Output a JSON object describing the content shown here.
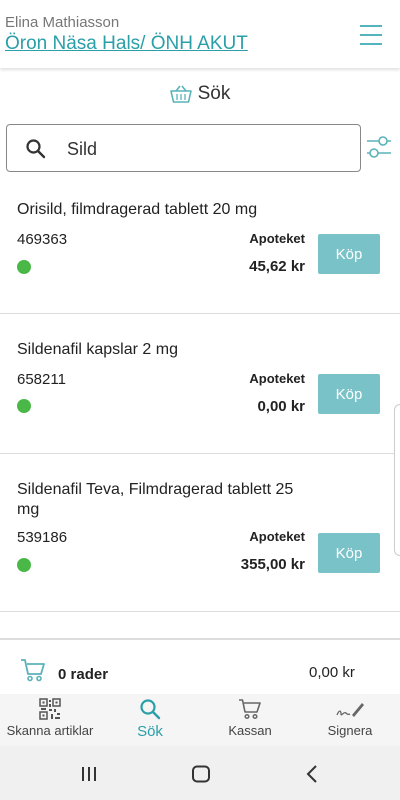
{
  "header": {
    "user_name": "Elina Mathiasson",
    "department": "Öron Näsa Hals/ ÖNH AKUT",
    "menu_icon": "hamburger-menu-icon"
  },
  "search": {
    "title": "Sök",
    "title_icon": "basket-icon",
    "query": "Sild",
    "filter_icon": "filter-sliders-icon"
  },
  "products": [
    {
      "name": "Orisild, filmdragerad tablett 20 mg",
      "code": "469363",
      "source": "Apoteket",
      "price": "45,62 kr",
      "buy_label": "Köp",
      "status_color": "#4ab847"
    },
    {
      "name": "Sildenafil kapslar 2 mg",
      "code": "658211",
      "source": "Apoteket",
      "price": "0,00 kr",
      "buy_label": "Köp",
      "status_color": "#4ab847"
    },
    {
      "name": "Sildenafil Teva, Filmdragerad tablett 25 mg",
      "code": "539186",
      "source": "Apoteket",
      "price": "355,00 kr",
      "buy_label": "Köp",
      "status_color": "#4ab847"
    }
  ],
  "cart": {
    "rows_label": "0 rader",
    "total": "0,00 kr"
  },
  "nav": {
    "items": [
      {
        "label": "Skanna artiklar",
        "icon": "qr-code-icon"
      },
      {
        "label": "Sök",
        "icon": "search-icon",
        "active": true
      },
      {
        "label": "Kassan",
        "icon": "cart-icon"
      },
      {
        "label": "Signera",
        "icon": "signature-pen-icon"
      }
    ]
  },
  "colors": {
    "accent": "#2a9fa8",
    "button": "#79c2c8",
    "status_ok": "#4ab847"
  }
}
